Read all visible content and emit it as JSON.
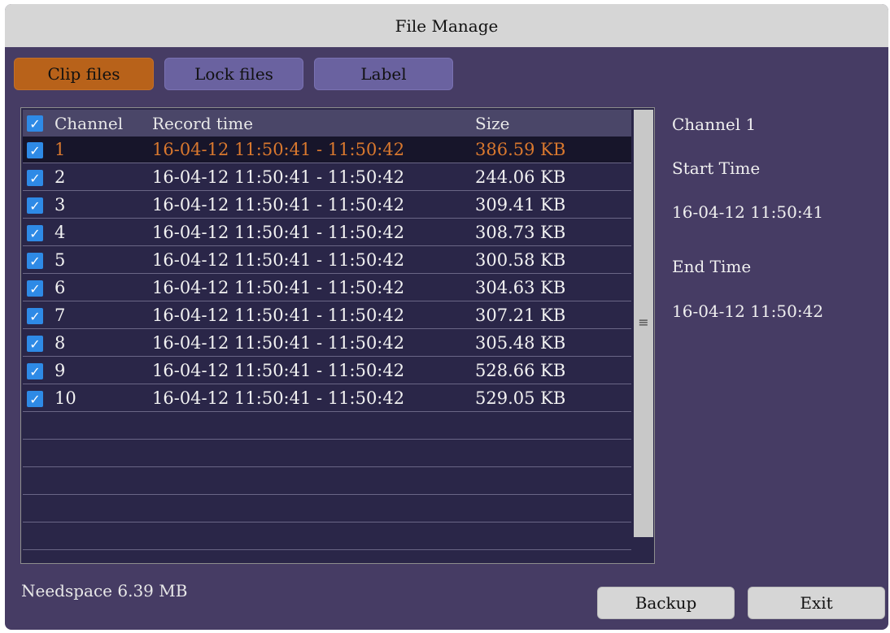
{
  "window": {
    "title": "File Manage"
  },
  "tabs": [
    {
      "label": "Clip files",
      "active": true
    },
    {
      "label": "Lock files",
      "active": false
    },
    {
      "label": "Label",
      "active": false
    }
  ],
  "table": {
    "columns": [
      "Channel",
      "Record time",
      "Size"
    ],
    "header_checked": true,
    "rows": [
      {
        "channel": "1",
        "time": "16-04-12 11:50:41 - 11:50:42",
        "size": "386.59 KB",
        "checked": true,
        "selected": true
      },
      {
        "channel": "2",
        "time": "16-04-12 11:50:41 - 11:50:42",
        "size": "244.06 KB",
        "checked": true
      },
      {
        "channel": "3",
        "time": "16-04-12 11:50:41 - 11:50:42",
        "size": "309.41 KB",
        "checked": true
      },
      {
        "channel": "4",
        "time": "16-04-12 11:50:41 - 11:50:42",
        "size": "308.73 KB",
        "checked": true
      },
      {
        "channel": "5",
        "time": "16-04-12 11:50:41 - 11:50:42",
        "size": "300.58 KB",
        "checked": true
      },
      {
        "channel": "6",
        "time": "16-04-12 11:50:41 - 11:50:42",
        "size": "304.63 KB",
        "checked": true
      },
      {
        "channel": "7",
        "time": "16-04-12 11:50:41 - 11:50:42",
        "size": "307.21 KB",
        "checked": true
      },
      {
        "channel": "8",
        "time": "16-04-12 11:50:41 - 11:50:42",
        "size": "305.48 KB",
        "checked": true
      },
      {
        "channel": "9",
        "time": "16-04-12 11:50:41 - 11:50:42",
        "size": "528.66 KB",
        "checked": true
      },
      {
        "channel": "10",
        "time": "16-04-12 11:50:41 - 11:50:42",
        "size": "529.05 KB",
        "checked": true
      }
    ]
  },
  "details": {
    "channel": "Channel  1",
    "start_label": "Start Time",
    "start_value": "16-04-12 11:50:41",
    "end_label": "End Time",
    "end_value": "16-04-12 11:50:42"
  },
  "footer": {
    "needspace": "Needspace  6.39 MB",
    "backup_label": "Backup",
    "exit_label": "Exit"
  },
  "icons": {
    "checkbox": "checkmark-icon",
    "scroll_grip": "grip-lines-icon"
  },
  "colors": {
    "background": "#463c64",
    "active_tab": "#b8621a",
    "tab": "#6a62a0",
    "selected_text": "#d9782e",
    "checkbox": "#2e8ae6"
  }
}
